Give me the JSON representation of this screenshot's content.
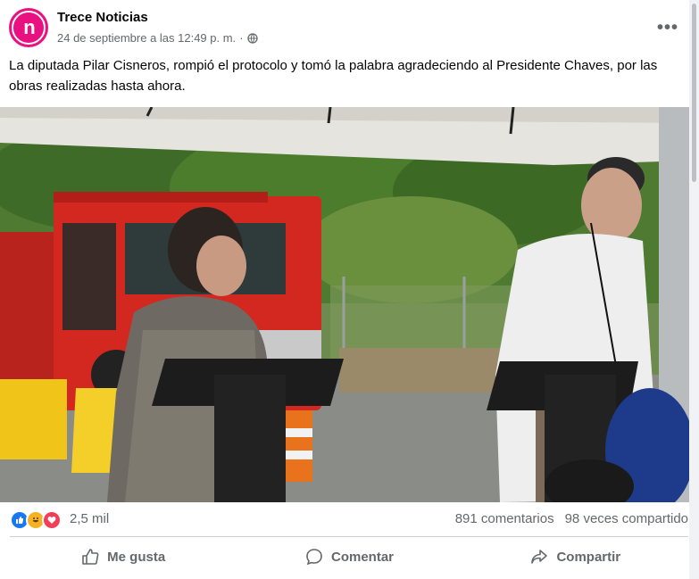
{
  "post": {
    "page_name": "Trece Noticias",
    "avatar_text": "n",
    "timestamp": "24 de septiembre a las 12:49 p. m.",
    "separator": "·",
    "privacy_icon": "globe-icon",
    "more_icon": "more-options-icon",
    "caption": "La diputada Pilar Cisneros, rompió el protocolo y tomó la palabra agradeciendo al Presidente Chaves, por las obras realizadas hasta ahora."
  },
  "photo": {
    "description_icon": "post-photo"
  },
  "reactions": {
    "icons": [
      "like-reaction-icon",
      "haha-reaction-icon",
      "love-reaction-icon"
    ],
    "count": "2,5 mil",
    "comments": "891 comentarios",
    "shares": "98 veces compartido"
  },
  "actions": {
    "like_label": "Me gusta",
    "comment_label": "Comentar",
    "share_label": "Compartir"
  },
  "colors": {
    "brand": "#e8117f",
    "like": "#1877f2",
    "haha": "#f7b125",
    "love": "#f33e58",
    "muted": "#65676b"
  }
}
